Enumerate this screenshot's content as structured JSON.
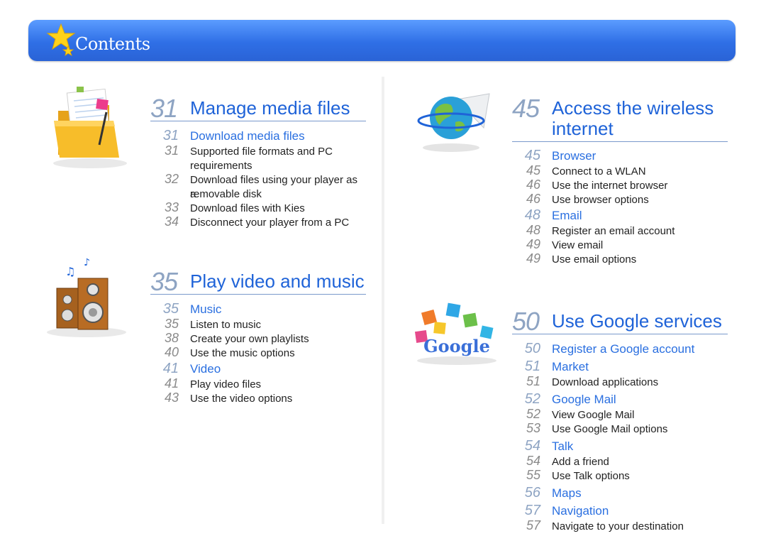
{
  "header": {
    "title": "Contents"
  },
  "sections": {
    "media": {
      "num": "31",
      "title": "Manage media files",
      "items": [
        {
          "num": "31",
          "text": "Download media files"
        },
        {
          "num": "31",
          "text": "Supported file formats and PC"
        },
        {
          "num": "",
          "text": "requirements"
        },
        {
          "num": "32",
          "text": "Download files using your player as a"
        },
        {
          "num": "",
          "text": "removable disk"
        },
        {
          "num": "33",
          "text": "Download files with Kies"
        },
        {
          "num": "34",
          "text": "Disconnect your player from a PC"
        }
      ]
    },
    "music": {
      "num": "35",
      "title": "Play video and music",
      "items": [
        {
          "num": "35",
          "text": "Music"
        },
        {
          "num": "35",
          "text": "Listen to music"
        },
        {
          "num": "38",
          "text": "Create your own playlists"
        },
        {
          "num": "40",
          "text": "Use the music options"
        },
        {
          "num": "41",
          "text": "Video"
        },
        {
          "num": "41",
          "text": "Play video files"
        },
        {
          "num": "43",
          "text": "Use the video options"
        }
      ]
    },
    "internet": {
      "num": "45",
      "title_line1": "Access the wireless",
      "title_line2": "internet",
      "items": [
        {
          "num": "45",
          "text": "Browser"
        },
        {
          "num": "45",
          "text": "Connect to a WLAN"
        },
        {
          "num": "46",
          "text": "Use the internet browser"
        },
        {
          "num": "46",
          "text": "Use browser options"
        },
        {
          "num": "48",
          "text": "Email"
        },
        {
          "num": "48",
          "text": "Register an email account"
        },
        {
          "num": "49",
          "text": "View email"
        },
        {
          "num": "49",
          "text": "Use email options"
        }
      ]
    },
    "google": {
      "num": "50",
      "title": "Use Google services",
      "logo_text": "Google",
      "items": [
        {
          "num": "50",
          "text": "Register a Google account"
        },
        {
          "num": "51",
          "text": "Market"
        },
        {
          "num": "51",
          "text": "Download applications"
        },
        {
          "num": "52",
          "text": "Google Mail"
        },
        {
          "num": "52",
          "text": "View Google Mail"
        },
        {
          "num": "53",
          "text": "Use Google Mail options"
        },
        {
          "num": "54",
          "text": "Talk"
        },
        {
          "num": "54",
          "text": "Add a friend"
        },
        {
          "num": "55",
          "text": "Use Talk options"
        },
        {
          "num": "56",
          "text": "Maps"
        },
        {
          "num": "57",
          "text": "Navigation"
        },
        {
          "num": "57",
          "text": "Navigate to your destination"
        }
      ]
    }
  },
  "icons": {
    "header": "star-icon",
    "media": "folder-icon",
    "music": "speaker-icon",
    "internet": "globe-icon",
    "google": "google-cubes-icon"
  },
  "colors": {
    "accent": "#1f63d8",
    "header": "#2f6fe6",
    "number": "#8ea4c3"
  }
}
